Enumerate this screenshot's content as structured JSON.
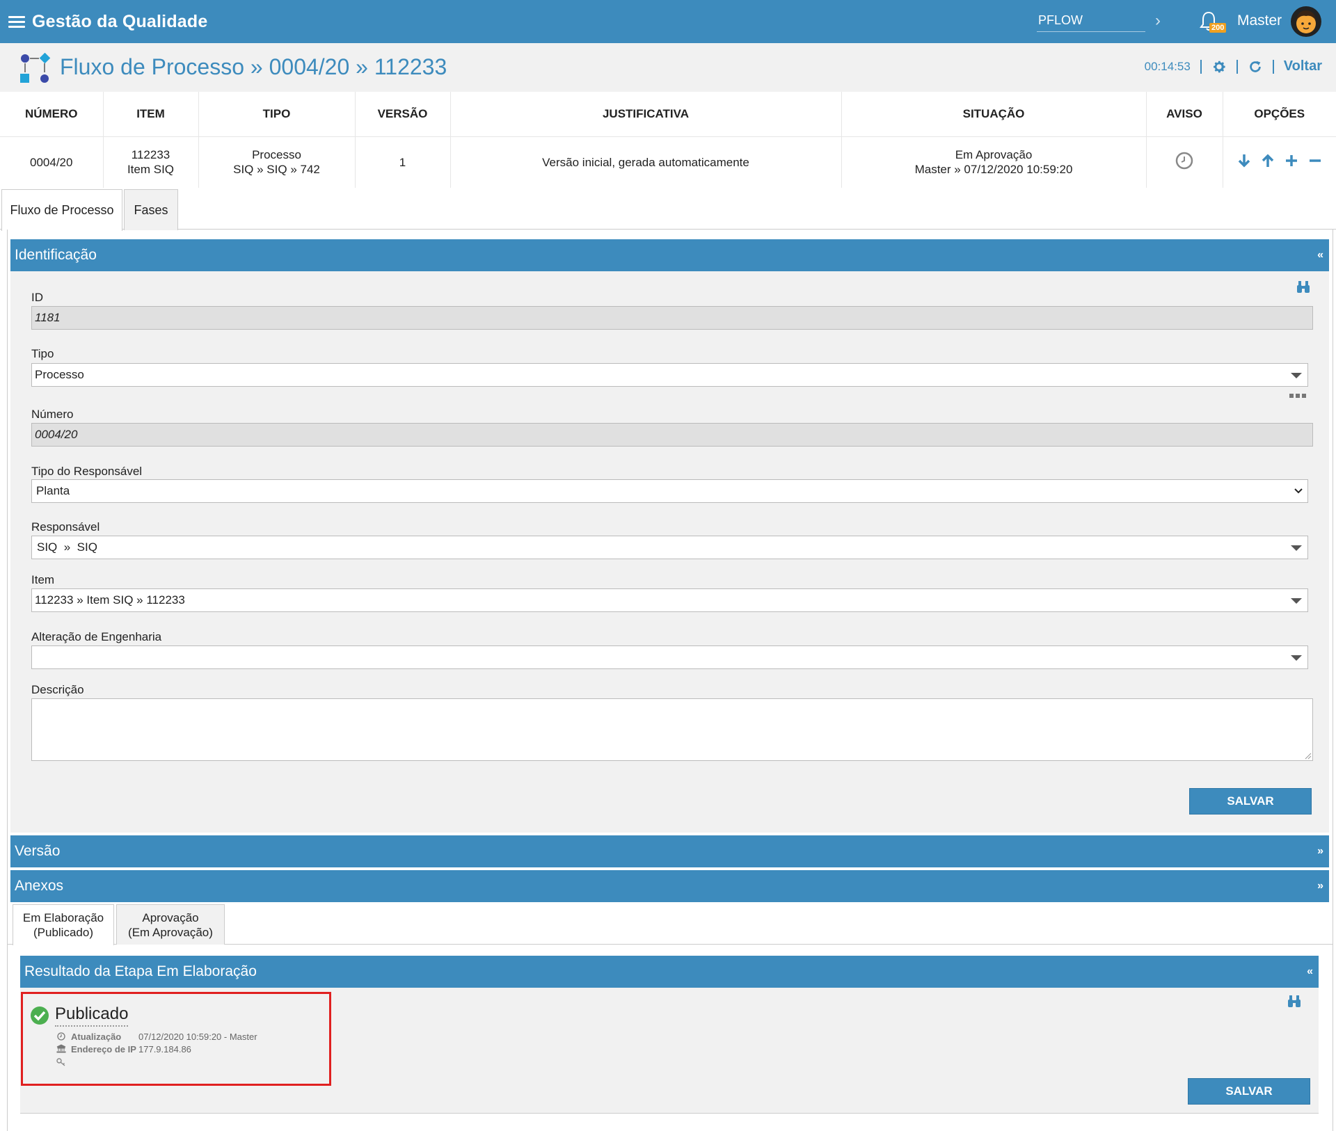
{
  "app": {
    "title": "Gestão da Qualidade"
  },
  "topbar": {
    "env_value": "PFLOW",
    "notifications": "200",
    "user": "Master"
  },
  "header": {
    "title": "Fluxo de Processo » 0004/20 » 112233",
    "timer": "00:14:53",
    "back": "Voltar"
  },
  "summary": {
    "headers": [
      "NÚMERO",
      "ITEM",
      "TIPO",
      "VERSÃO",
      "JUSTIFICATIVA",
      "SITUAÇÃO",
      "AVISO",
      "OPÇÕES"
    ],
    "row": {
      "numero": "0004/20",
      "item_code": "112233",
      "item_name": "Item SIQ",
      "tipo": "Processo",
      "tipo_path": "SIQ » SIQ » 742",
      "versao": "1",
      "justificativa": "Versão inicial, gerada automaticamente",
      "situacao": "Em Aprovação",
      "situacao_detail": "Master » 07/12/2020 10:59:20"
    }
  },
  "tabs": [
    "Fluxo de Processo",
    "Fases"
  ],
  "identificacao": {
    "title": "Identificação",
    "fields": {
      "id": {
        "label": "ID",
        "value": "1181"
      },
      "tipo": {
        "label": "Tipo",
        "value": "Processo"
      },
      "numero": {
        "label": "Número",
        "value": "0004/20"
      },
      "tipo_responsavel": {
        "label": "Tipo do Responsável",
        "value": "Planta"
      },
      "responsavel": {
        "label": "Responsável",
        "value": "SIQ  »  SIQ"
      },
      "item": {
        "label": "Item",
        "value": "112233 » Item SIQ » 112233"
      },
      "alteracao": {
        "label": "Alteração de Engenharia",
        "value": ""
      },
      "descricao": {
        "label": "Descrição",
        "value": ""
      }
    },
    "save": "SALVAR"
  },
  "versao": {
    "title": "Versão"
  },
  "anexos": {
    "title": "Anexos"
  },
  "subtabs": [
    {
      "line1": "Em Elaboração",
      "line2": "(Publicado)"
    },
    {
      "line1": "Aprovação",
      "line2": "(Em Aprovação)"
    }
  ],
  "resultado": {
    "title": "Resultado da Etapa Em Elaboração",
    "status": "Publicado",
    "atualizacao_label": "Atualização",
    "atualizacao_value": "07/12/2020 10:59:20 - Master",
    "ip_label": "Endereço de IP",
    "ip_value": "177.9.184.86",
    "save": "SALVAR"
  },
  "colors": {
    "primary": "#3d8bbd",
    "highlight": "#e02020",
    "success": "#4caf50",
    "badge": "#f0a020"
  }
}
